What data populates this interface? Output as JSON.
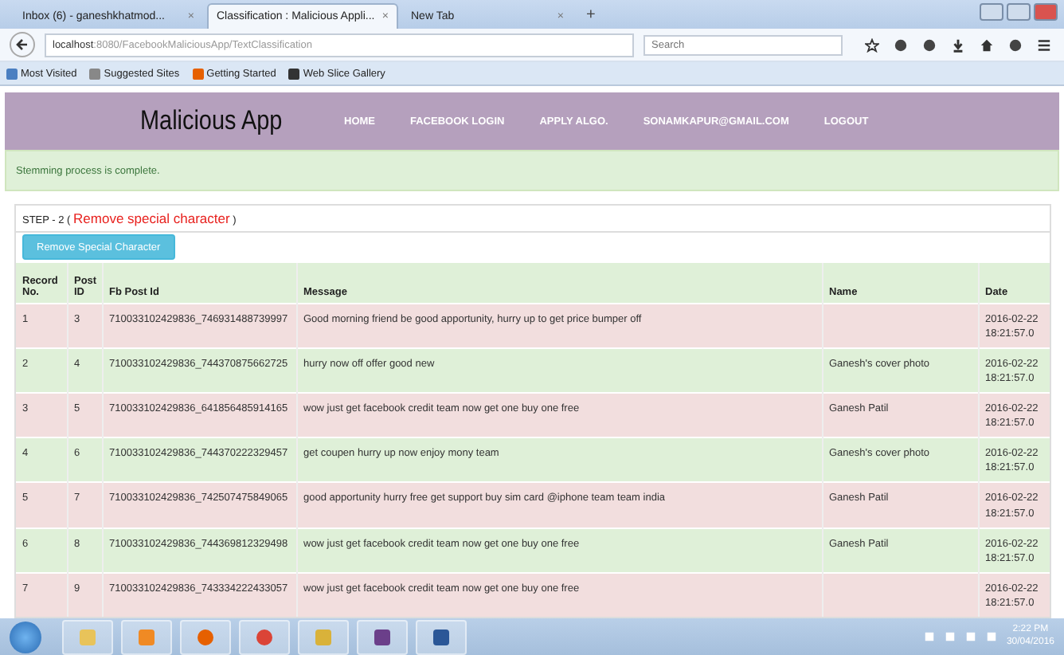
{
  "browser": {
    "tabs": [
      {
        "label": "Inbox (6) - ganeshkhatmod...",
        "close": "×",
        "selected": false
      },
      {
        "label": "Classification : Malicious Appli...",
        "close": "×",
        "selected": true
      },
      {
        "label": "New Tab",
        "close": "×",
        "selected": false
      }
    ],
    "new_tab": "+",
    "url_host": "localhost",
    "url_path": ":8080/FacebookMaliciousApp/TextClassification",
    "search": {
      "placeholder": "Search"
    },
    "bookmarks": [
      "Most Visited",
      "Suggested Sites",
      "Getting Started",
      "Web Slice Gallery"
    ]
  },
  "app": {
    "brand": "Malicious App",
    "nav": [
      "HOME",
      "FACEBOOK LOGIN",
      "APPLY ALGO.",
      "SONAMKAPUR@GMAIL.COM",
      "LOGOUT"
    ]
  },
  "alert": "Stemming process is complete.",
  "step": {
    "prefix": "STEP - 2 (",
    "title": "Remove special character",
    "suffix": ")"
  },
  "action_button": "Remove Special Character",
  "table": {
    "columns": [
      "Record No.",
      "Post ID",
      "Fb Post Id",
      "Message",
      "Name",
      "Date"
    ],
    "rows": [
      {
        "cells": [
          "1",
          "3",
          "710033102429836_746931488739997",
          "Good morning friend be good apportunity, hurry up to get price bumper off",
          "",
          "2016-02-22 18:21:57.0"
        ],
        "color": "#f2dede"
      },
      {
        "cells": [
          "2",
          "4",
          "710033102429836_744370875662725",
          "hurry now off offer good new",
          "Ganesh's cover photo",
          "2016-02-22 18:21:57.0"
        ],
        "color": "#dff0d8"
      },
      {
        "cells": [
          "3",
          "5",
          "710033102429836_641856485914165",
          "wow just get facebook credit team now get one buy one free",
          "Ganesh Patil",
          "2016-02-22 18:21:57.0"
        ],
        "color": "#f2dede"
      },
      {
        "cells": [
          "4",
          "6",
          "710033102429836_744370222329457",
          "get coupen hurry up now enjoy mony team",
          "Ganesh's cover photo",
          "2016-02-22 18:21:57.0"
        ],
        "color": "#dff0d8"
      },
      {
        "cells": [
          "5",
          "7",
          "710033102429836_742507475849065",
          "good apportunity hurry free get support buy sim card @iphone team team india",
          "Ganesh Patil",
          "2016-02-22 18:21:57.0"
        ],
        "color": "#f2dede"
      },
      {
        "cells": [
          "6",
          "8",
          "710033102429836_744369812329498",
          "wow just get facebook credit team now get one buy one free",
          "Ganesh Patil",
          "2016-02-22 18:21:57.0"
        ],
        "color": "#dff0d8"
      },
      {
        "cells": [
          "7",
          "9",
          "710033102429836_743334222433057",
          "wow just get facebook credit team now get one buy one free",
          "",
          "2016-02-22 18:21:57.0"
        ],
        "color": "#f2dede"
      }
    ]
  },
  "taskbar": {
    "time": "2:22 PM",
    "date": "30/04/2016"
  }
}
